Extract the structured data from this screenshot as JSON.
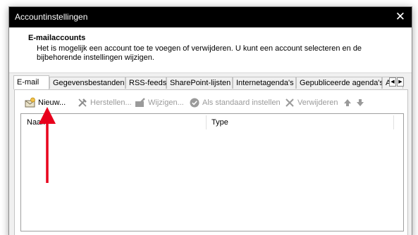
{
  "window": {
    "title": "Accountinstellingen",
    "close_glyph": "✕"
  },
  "header": {
    "title": "E-mailaccounts",
    "description": "Het is mogelijk een account toe te voegen of verwijderen. U kunt een account selecteren en de bijbehorende instellingen wijzigen."
  },
  "tabs": [
    {
      "label": "E-mail",
      "active": true
    },
    {
      "label": "Gegevensbestanden",
      "active": false
    },
    {
      "label": "RSS-feeds",
      "active": false
    },
    {
      "label": "SharePoint-lijsten",
      "active": false
    },
    {
      "label": "Internetagenda's",
      "active": false
    },
    {
      "label": "Gepubliceerde agenda's",
      "active": false
    },
    {
      "label": "Ad",
      "active": false
    }
  ],
  "tab_scroll": {
    "left": "◀",
    "right": "▶"
  },
  "toolbar": {
    "new_label": "Nieuw...",
    "repair_label": "Herstellen...",
    "change_label": "Wijzigen...",
    "default_label": "Als standaard instellen",
    "remove_label": "Verwijderen"
  },
  "account_list": {
    "columns": [
      "Naam",
      "Type"
    ],
    "rows": []
  },
  "annotation": {
    "arrow_color": "#e8001c"
  }
}
